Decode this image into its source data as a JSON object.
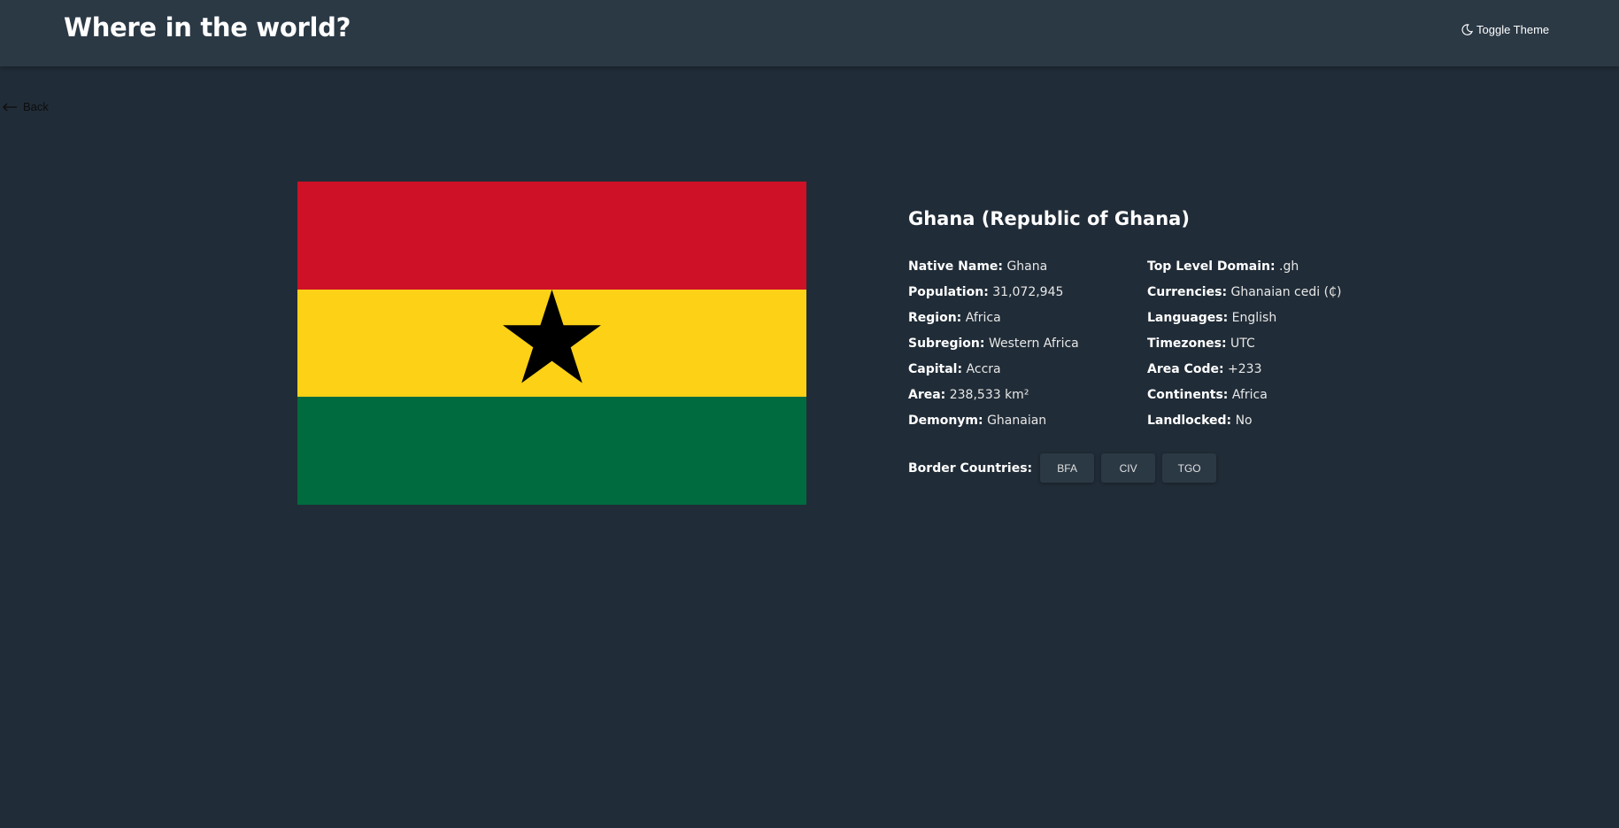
{
  "header": {
    "title": "Where in the world?",
    "theme_toggle_label": "Toggle Theme",
    "theme_icon": "moon-icon"
  },
  "navigation": {
    "back_label": "Back",
    "back_icon": "arrow-left-icon"
  },
  "country": {
    "name": "Ghana (Republic of Ghana)",
    "flag_colors": [
      "#ce1126",
      "#fcd116",
      "#006b3f",
      "#000000"
    ],
    "left_details": [
      {
        "label": "Native Name:",
        "value": "Ghana"
      },
      {
        "label": "Population:",
        "value": "31,072,945"
      },
      {
        "label": "Region:",
        "value": "Africa"
      },
      {
        "label": "Subregion:",
        "value": "Western Africa"
      },
      {
        "label": "Capital:",
        "value": "Accra"
      },
      {
        "label": "Area:",
        "value": "238,533 km²"
      },
      {
        "label": "Demonym:",
        "value": "Ghanaian"
      }
    ],
    "right_details": [
      {
        "label": "Top Level Domain:",
        "value": ".gh"
      },
      {
        "label": "Currencies:",
        "value": "Ghanaian cedi (₵)"
      },
      {
        "label": "Languages:",
        "value": "English"
      },
      {
        "label": "Timezones:",
        "value": "UTC"
      },
      {
        "label": "Area Code:",
        "value": "+233"
      },
      {
        "label": "Continents:",
        "value": "Africa"
      },
      {
        "label": "Landlocked:",
        "value": "No"
      }
    ],
    "border_label": "Border Countries:",
    "border_countries": [
      "BFA",
      "CIV",
      "TGO"
    ]
  },
  "colors": {
    "background": "#202c37",
    "surface": "#2b3945",
    "text": "#ffffff"
  }
}
